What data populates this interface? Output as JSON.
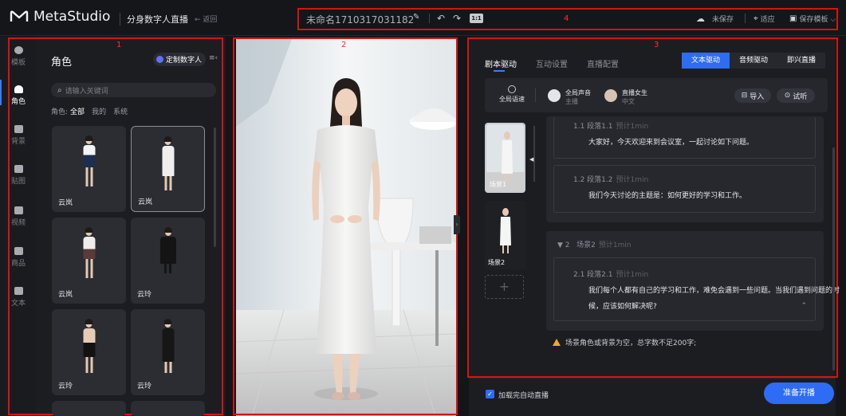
{
  "header": {
    "brand": "MetaStudio",
    "product": "分身数字人直播",
    "back_label": "← 返回",
    "doc_title": "未命名1710317031182",
    "speed_badge": "1:1",
    "save_status": "未保存",
    "adapt_label": "适应",
    "save_template_label": "保存模板 ⌵"
  },
  "annotations": {
    "one": "1",
    "two": "2",
    "three": "3",
    "four": "4"
  },
  "sidebar": {
    "items": [
      {
        "label": "模板"
      },
      {
        "label": "角色"
      },
      {
        "label": "背景"
      },
      {
        "label": "贴图"
      },
      {
        "label": "视频"
      },
      {
        "label": "商品"
      },
      {
        "label": "文本"
      }
    ]
  },
  "role_panel": {
    "title": "角色",
    "custom_btn": "定制数字人",
    "search_placeholder": "请输入关键词",
    "filter_label": "角色:",
    "filters": [
      "全部",
      "我的",
      "系统"
    ],
    "cards": [
      {
        "name": "云岚"
      },
      {
        "name": "云岚"
      },
      {
        "name": "云岚"
      },
      {
        "name": "云玲"
      },
      {
        "name": "云玲"
      },
      {
        "name": "云玲"
      }
    ]
  },
  "script_panel": {
    "tabs": [
      "剧本驱动",
      "互动设置",
      "直播配置"
    ],
    "drive_modes": [
      "文本驱动",
      "音频驱动",
      "即兴直播"
    ],
    "global_speed": "全局语速",
    "voice_name": "全局声音",
    "voice_role": "主播",
    "voice_person": "直播女生",
    "voice_lang": "中文",
    "import_label": "导入",
    "preview_label": "试听",
    "scenes": [
      {
        "thumb_label": "场景1"
      },
      {
        "thumb_label": "场景2"
      }
    ],
    "scene2_title": "场景2",
    "scene2_index": "▼  2",
    "scene2_est": "预计1min",
    "paragraphs": [
      {
        "title": "1.1  段落1.1",
        "est": "预计1min",
        "text": "大家好，今天欢迎来到会议室，一起讨论如下问题。"
      },
      {
        "title": "1.2  段落1.2",
        "est": "预计1min",
        "text": "我们今天讨论的主题是：如何更好的学习和工作。"
      },
      {
        "title": "2.1  段落2.1",
        "est": "预计1min",
        "text1": "我们每个人都有自己的学习和工作，难免会遇到一些问题。当我们遇到问题的时",
        "text2": "候，应该如何解决呢?"
      }
    ],
    "warning": "场景角色或背景为空，总字数不足200字;",
    "auto_live": "加载完自动直播",
    "go_live": "准备开播"
  }
}
